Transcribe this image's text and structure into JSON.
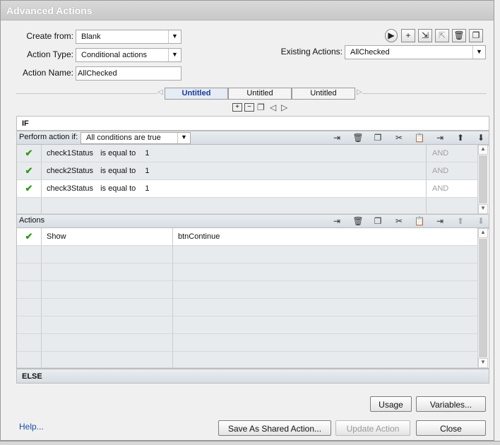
{
  "window": {
    "title": "Advanced Actions"
  },
  "form": {
    "create_from_label": "Create from:",
    "create_from_value": "Blank",
    "action_type_label": "Action Type:",
    "action_type_value": "Conditional actions",
    "action_name_label": "Action Name:",
    "action_name_value": "AllChecked",
    "existing_actions_label": "Existing Actions:",
    "existing_actions_value": "AllChecked"
  },
  "toolbar_icons": [
    "preview-icon",
    "add-icon",
    "import-icon",
    "export-icon",
    "delete-icon",
    "duplicate-icon"
  ],
  "tabs": [
    {
      "label": "Untitled",
      "active": true
    },
    {
      "label": "Untitled",
      "active": false
    },
    {
      "label": "Untitled",
      "active": false
    }
  ],
  "if_section": {
    "header": "IF",
    "perform_label": "Perform action if:",
    "perform_value": "All conditions are true",
    "conditions": [
      {
        "variable": "check1Status",
        "operator": "is equal to",
        "value": "1",
        "logic": "AND"
      },
      {
        "variable": "check2Status",
        "operator": "is equal to",
        "value": "1",
        "logic": "AND"
      },
      {
        "variable": "check3Status",
        "operator": "is equal to",
        "value": "1",
        "logic": "AND"
      }
    ]
  },
  "actions_section": {
    "header": "Actions",
    "rows": [
      {
        "action": "Show",
        "target": "btnContinue"
      }
    ]
  },
  "else_section": {
    "header": "ELSE"
  },
  "buttons": {
    "usage": "Usage",
    "variables": "Variables...",
    "save_shared": "Save As Shared Action...",
    "update": "Update Action",
    "close": "Close"
  },
  "help_link": "Help..."
}
